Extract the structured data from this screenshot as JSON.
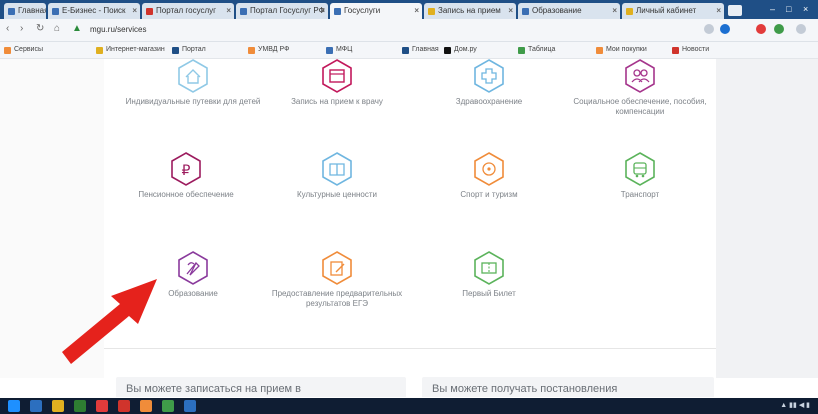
{
  "browser": {
    "tabs": [
      {
        "label": "Главная"
      },
      {
        "label": "Е-Бизнес - Поиск"
      },
      {
        "label": "Портал госуслуг"
      },
      {
        "label": "Портал Госуслуг РФ"
      },
      {
        "label": "Госуслуги"
      },
      {
        "label": "Запись на прием"
      },
      {
        "label": "Образование"
      },
      {
        "label": "Личный кабинет"
      }
    ],
    "url": "mgu.ru/services",
    "bookmarks": [
      "Сервисы",
      "Интернет-магазин",
      "Портал",
      "УМВД РФ",
      "МФЦ",
      "Главная",
      "Дом.ру",
      "Таблица",
      "Мои покупки",
      "Новости"
    ]
  },
  "services": [
    {
      "label": "Индивидуальные путевки для детей",
      "icon": "house-icon",
      "color": "#8fc9e6"
    },
    {
      "label": "Запись на прием к врачу",
      "icon": "calendar-icon",
      "color": "#c2185b"
    },
    {
      "label": "Здравоохранение",
      "icon": "medical-cross-icon",
      "color": "#6fb6e0"
    },
    {
      "label": "Социальное обеспечение, пособия, компенсации",
      "icon": "people-icon",
      "color": "#a5358c"
    },
    {
      "label": "Пенсионное обеспечение",
      "icon": "ruble-icon",
      "color": "#9c1b5e"
    },
    {
      "label": "Культурные ценности",
      "icon": "book-icon",
      "color": "#6fb6e0"
    },
    {
      "label": "Спорт и туризм",
      "icon": "ball-icon",
      "color": "#f08c3a"
    },
    {
      "label": "Транспорт",
      "icon": "bus-icon",
      "color": "#5bb35b"
    },
    {
      "label": "Образование",
      "icon": "education-icon",
      "color": "#8a3a9c"
    },
    {
      "label": "Предоставление предварительных результатов ЕГЭ",
      "icon": "document-icon",
      "color": "#f08c3a"
    },
    {
      "label": "Первый Билет",
      "icon": "ticket-icon",
      "color": "#5bb35b"
    }
  ],
  "info": {
    "left": "Вы можете записаться на прием в",
    "right": "Вы можете получать постановления"
  },
  "annotation": {
    "arrow_color": "#e5221c"
  }
}
